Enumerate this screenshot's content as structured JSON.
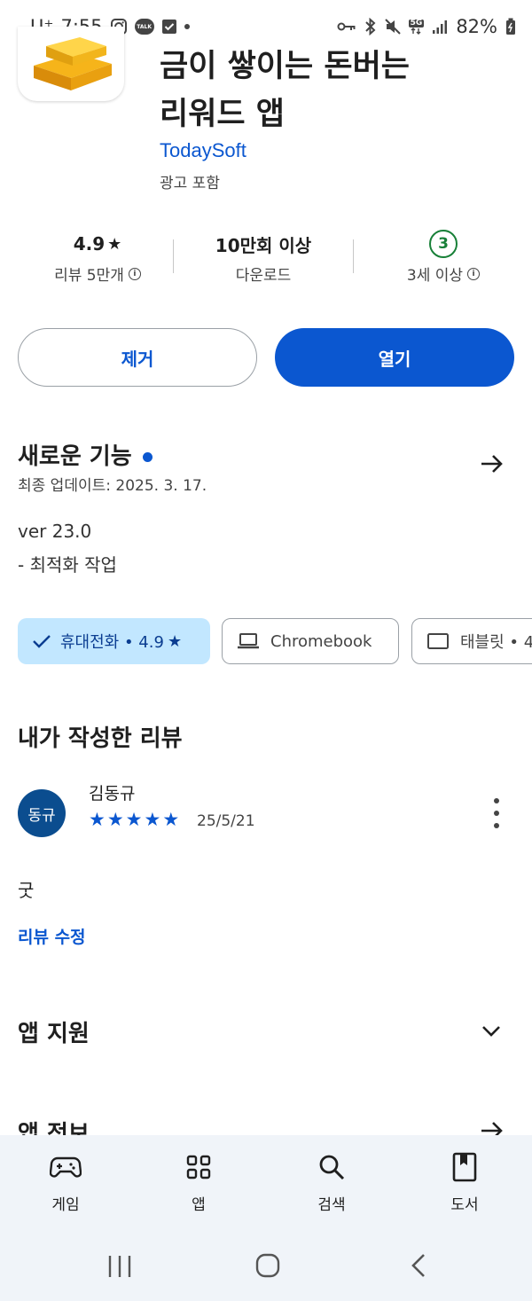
{
  "status_bar": {
    "carrier": "U⁺",
    "time": "7:55",
    "talk_label": "TALK",
    "network": "5G",
    "battery": "82%"
  },
  "app": {
    "title_line1": "금이 쌓이는 돈버는",
    "title_line2": "리워드 앱",
    "developer": "TodaySoft",
    "ads_note": "광고 포함",
    "icon": "gold-bars-icon"
  },
  "stats": {
    "rating_value": "4.9",
    "rating_label": "리뷰 5만개",
    "downloads_value": "10만회 이상",
    "downloads_label": "다운로드",
    "age_value": "3",
    "age_label": "3세 이상"
  },
  "buttons": {
    "uninstall": "제거",
    "open": "열기"
  },
  "whats_new": {
    "title": "새로운 기능",
    "updated": "최종 업데이트: 2025. 3. 17.",
    "version": "ver 23.0",
    "note": "- 최적화 작업"
  },
  "device_chips": {
    "phone": "휴대전화 • 4.9",
    "chromebook": "Chromebook",
    "tablet": "태블릿 • 4"
  },
  "my_review": {
    "title": "내가 작성한 리뷰",
    "avatar_text": "동규",
    "reviewer": "김동규",
    "stars": 5,
    "date": "25/5/21",
    "text": "굿",
    "edit_label": "리뷰 수정"
  },
  "sections": {
    "app_support": "앱 지원",
    "app_info": "앱 정보"
  },
  "bottom_nav": {
    "games": "게임",
    "apps": "앱",
    "search": "검색",
    "books": "도서"
  },
  "colors": {
    "accent": "#0b57d0",
    "chip_selected": "#c2e7ff",
    "age_green": "#188038",
    "nav_bg": "#f0f4f9"
  }
}
